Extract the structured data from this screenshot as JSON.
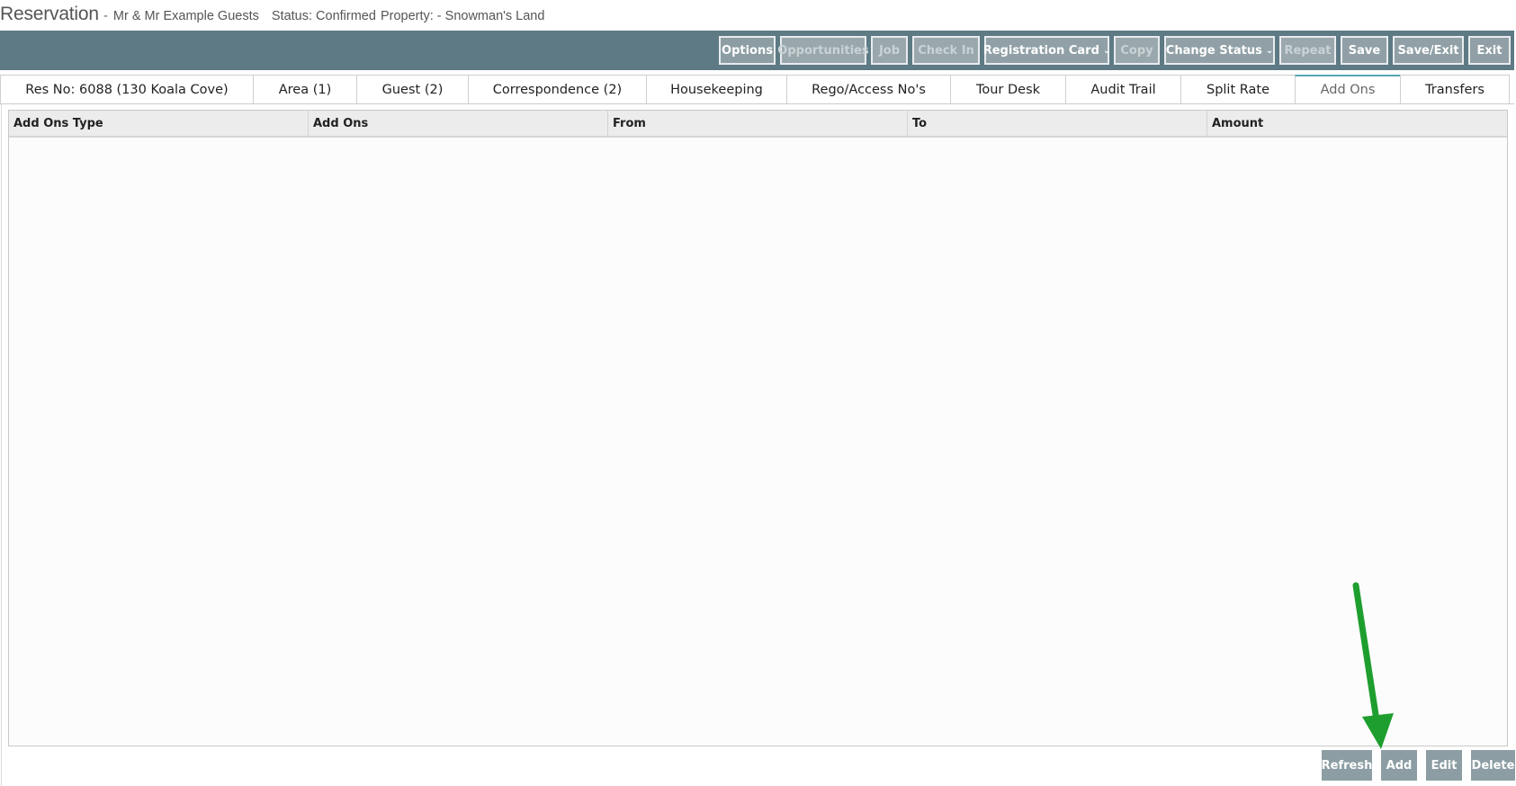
{
  "header": {
    "title": "Reservation",
    "separator": "-",
    "guest_name": "Mr & Mr  Example Guests",
    "status": "Status: Confirmed",
    "property": "Property: - Snowman's Land"
  },
  "toolbar": {
    "buttons": [
      {
        "label": "Options",
        "enabled": true
      },
      {
        "label": "Opportunities",
        "enabled": false
      },
      {
        "label": "Job",
        "enabled": false
      },
      {
        "label": "Check In",
        "enabled": false
      },
      {
        "label": "Registration Card",
        "enabled": true,
        "dropdown": true
      },
      {
        "label": "Copy",
        "enabled": false
      },
      {
        "label": "Change Status",
        "enabled": true,
        "dropdown": true
      },
      {
        "label": "Repeat",
        "enabled": false
      },
      {
        "label": "Save",
        "enabled": true
      },
      {
        "label": "Save/Exit",
        "enabled": true
      },
      {
        "label": "Exit",
        "enabled": true
      }
    ]
  },
  "tabs": [
    {
      "label": "Res No: 6088 (130 Koala Cove)"
    },
    {
      "label": "Area (1)"
    },
    {
      "label": "Guest (2)"
    },
    {
      "label": "Correspondence (2)"
    },
    {
      "label": "Housekeeping"
    },
    {
      "label": "Rego/Access No's"
    },
    {
      "label": "Tour Desk"
    },
    {
      "label": "Audit Trail"
    },
    {
      "label": "Split Rate"
    },
    {
      "label": "Add Ons",
      "active": true
    },
    {
      "label": "Transfers"
    }
  ],
  "grid": {
    "columns": [
      "Add Ons Type",
      "Add Ons",
      "From",
      "To",
      "Amount"
    ],
    "rows": []
  },
  "actions": {
    "refresh": "Refresh",
    "add": "Add",
    "edit": "Edit",
    "delete": "Delete"
  },
  "colors": {
    "toolbar_bg": "#5e7a85",
    "button_bg": "#8c9ea4",
    "active_tab_accent": "#5aa5b5",
    "annotation_arrow": "#1e9e2e"
  },
  "icons": {
    "dropdown": "chevron-down-icon",
    "annotation": "arrow-annotation-icon"
  }
}
